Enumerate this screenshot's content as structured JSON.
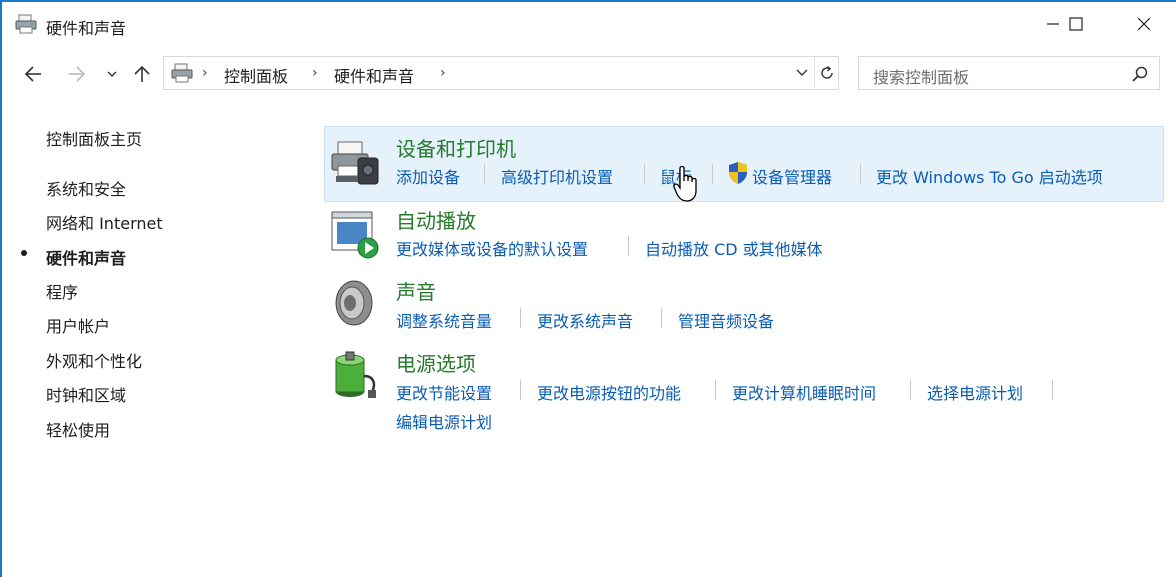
{
  "window": {
    "title": "硬件和声音"
  },
  "nav": {
    "breadcrumbs": [
      "控制面板",
      "硬件和声音"
    ],
    "search_placeholder": "搜索控制面板"
  },
  "sidebar": {
    "home": "控制面板主页",
    "items": [
      "系统和安全",
      "网络和 Internet",
      "硬件和声音",
      "程序",
      "用户帐户",
      "外观和个性化",
      "时钟和区域",
      "轻松使用"
    ],
    "active_index": 2
  },
  "categories": [
    {
      "title": "设备和打印机",
      "links": [
        "添加设备",
        "高级打印机设置",
        "鼠标",
        "设备管理器",
        "更改 Windows To Go 启动选项"
      ]
    },
    {
      "title": "自动播放",
      "links": [
        "更改媒体或设备的默认设置",
        "自动播放 CD 或其他媒体"
      ]
    },
    {
      "title": "声音",
      "links": [
        "调整系统音量",
        "更改系统声音",
        "管理音频设备"
      ]
    },
    {
      "title": "电源选项",
      "links": [
        "更改节能设置",
        "更改电源按钮的功能",
        "更改计算机睡眠时间",
        "选择电源计划",
        "编辑电源计划"
      ]
    }
  ],
  "colors": {
    "title_green": "#267a2c",
    "link_blue": "#0a5cb5",
    "highlight": "#e5f1fb",
    "window_border": "#1979ca"
  }
}
